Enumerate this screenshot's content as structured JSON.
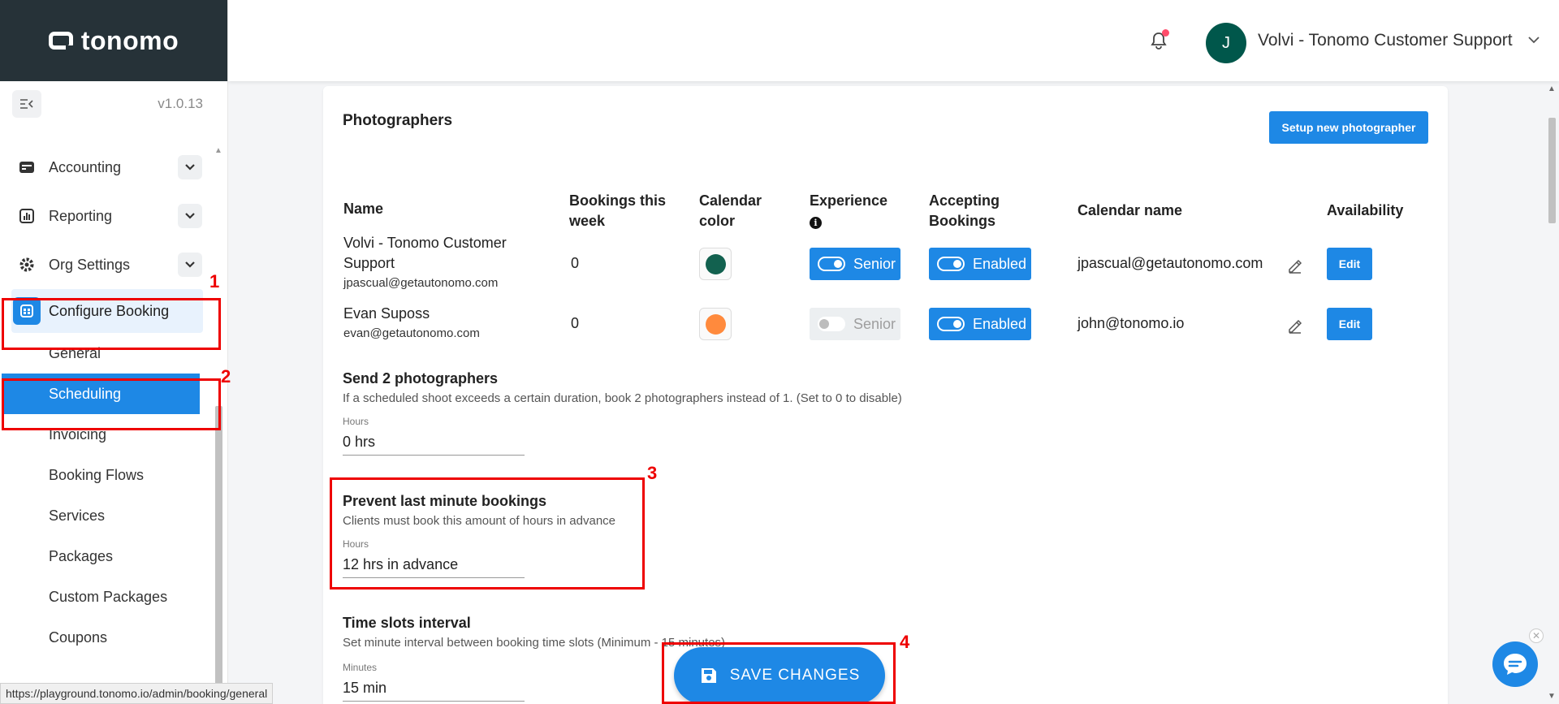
{
  "brand": {
    "name": "tonomo"
  },
  "sidebar": {
    "version": "v1.0.13",
    "items": [
      {
        "label": "Accounting",
        "icon": "wallet-icon"
      },
      {
        "label": "Reporting",
        "icon": "chart-icon"
      },
      {
        "label": "Org Settings",
        "icon": "gear-icon"
      },
      {
        "label": "Configure Booking",
        "icon": "calendar-icon"
      }
    ],
    "sub_items": [
      "General",
      "Scheduling",
      "Invoicing",
      "Booking Flows",
      "Services",
      "Packages",
      "Custom Packages",
      "Coupons"
    ]
  },
  "status_url": "https://playground.tonomo.io/admin/booking/general",
  "header": {
    "avatar_initial": "J",
    "user_name": "Volvi - Tonomo Customer Support"
  },
  "photographers": {
    "title": "Photographers",
    "setup_button": "Setup new photographer",
    "columns": {
      "name": "Name",
      "bookings_l1": "Bookings this",
      "bookings_l2": "week",
      "calendar_l1": "Calendar",
      "calendar_l2": "color",
      "experience": "Experience",
      "accepting_l1": "Accepting",
      "accepting_l2": "Bookings",
      "calendar_name": "Calendar name",
      "availability": "Availability"
    },
    "rows": [
      {
        "name_l1": "Volvi - Tonomo Customer",
        "name_l2": "Support",
        "email": "jpascual@getautonomo.com",
        "bookings": "0",
        "color": "#12614f",
        "experience": "Senior",
        "accepting": "Enabled",
        "calendar_name": "jpascual@getautonomo.com",
        "edit": "Edit"
      },
      {
        "name_l1": "Evan Suposs",
        "email": "evan@getautonomo.com",
        "bookings": "0",
        "color": "#ff8a3d",
        "experience": "Senior",
        "accepting": "Enabled",
        "calendar_name": "john@tonomo.io",
        "edit": "Edit"
      }
    ]
  },
  "send_two": {
    "title": "Send 2 photographers",
    "desc": "If a scheduled shoot exceeds a certain duration, book 2 photographers instead of 1. (Set to 0 to disable)",
    "label": "Hours",
    "value": "0 hrs"
  },
  "prevent_last": {
    "title": "Prevent last minute bookings",
    "desc": "Clients must book this amount of hours in advance",
    "label": "Hours",
    "value": "12 hrs in advance"
  },
  "time_slots": {
    "title": "Time slots interval",
    "desc": "Set minute interval between booking time slots (Minimum - 15 minutes)",
    "label": "Minutes",
    "value": "15 min"
  },
  "save_button": "SAVE CHANGES",
  "annotations": [
    "1",
    "2",
    "3",
    "4"
  ],
  "colors": {
    "accent": "#1e88e5",
    "sidebar_dark": "#263238",
    "annotation": "#e00000"
  }
}
